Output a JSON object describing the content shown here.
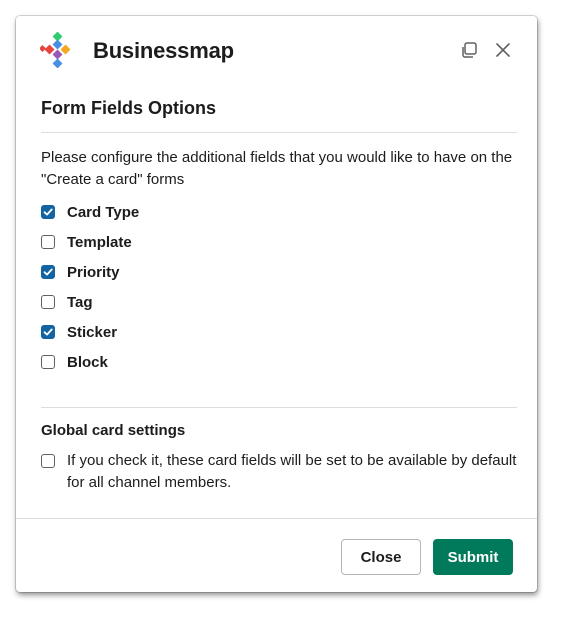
{
  "header": {
    "app_name": "Businessmap"
  },
  "dialog": {
    "title": "Form Fields Options",
    "description": "Please configure the additional fields that you would like to have on the \"Create a card\" forms",
    "fields": [
      {
        "label": "Card Type",
        "checked": true
      },
      {
        "label": "Template",
        "checked": false
      },
      {
        "label": "Priority",
        "checked": true
      },
      {
        "label": "Tag",
        "checked": false
      },
      {
        "label": "Sticker",
        "checked": true
      },
      {
        "label": "Block",
        "checked": false
      }
    ],
    "global": {
      "heading": "Global card settings",
      "option_text": "If you check it, these card fields will be set to be available by default for all channel members.",
      "checked": false
    }
  },
  "footer": {
    "close_label": "Close",
    "submit_label": "Submit"
  },
  "colors": {
    "checkbox_checked": "#1264a3",
    "submit_bg": "#007a5a",
    "logo_colors": [
      "#e8453c",
      "#f5a623",
      "#4a90e2",
      "#2ecc71",
      "#9b59b6"
    ]
  },
  "icons": {
    "popout": "popout-window-icon",
    "close": "close-icon",
    "check": "checkmark-icon"
  }
}
